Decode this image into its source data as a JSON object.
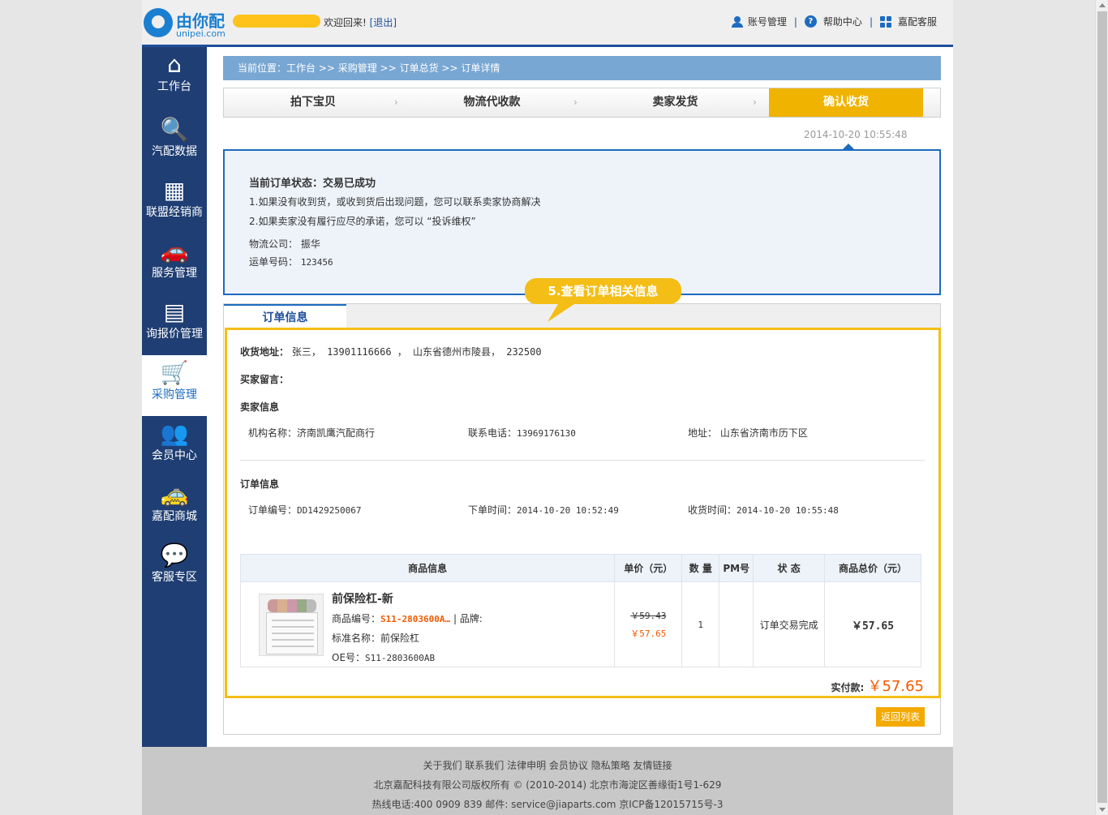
{
  "header": {
    "logo_text": "由你配",
    "logo_sub": "unipei.com",
    "welcome": "欢迎回来!",
    "logout": "[退出]",
    "links": [
      {
        "label": "账号管理",
        "icon": "user-icon"
      },
      {
        "label": "帮助中心",
        "icon": "help-icon"
      },
      {
        "label": "嘉配客服",
        "icon": "grid-icon"
      }
    ],
    "separator": "|"
  },
  "sidebar": {
    "items": [
      {
        "label": "工作台",
        "icon": "home-icon",
        "glyph": "⌂"
      },
      {
        "label": "汽配数据",
        "icon": "search-icon",
        "glyph": "🔍"
      },
      {
        "label": "联盟经销商",
        "icon": "building-icon",
        "glyph": "▦"
      },
      {
        "label": "服务管理",
        "icon": "car-icon",
        "glyph": "🚗"
      },
      {
        "label": "询报价管理",
        "icon": "document-icon",
        "glyph": "▤"
      },
      {
        "label": "采购管理",
        "icon": "cart-icon",
        "glyph": "🛒"
      },
      {
        "label": "会员中心",
        "icon": "members-icon",
        "glyph": "👥"
      },
      {
        "label": "嘉配商城",
        "icon": "taxi-icon",
        "glyph": "🚕"
      },
      {
        "label": "客服专区",
        "icon": "chat-icon",
        "glyph": "💬"
      }
    ],
    "active_index": 5
  },
  "breadcrumb": {
    "prefix": "当前位置：",
    "items": [
      "工作台",
      "采购管理",
      "订单总货",
      "订单详情"
    ],
    "sep": ">>"
  },
  "steps": [
    {
      "label": "拍下宝贝",
      "done": false
    },
    {
      "label": "物流代收款",
      "done": false
    },
    {
      "label": "卖家发货",
      "done": false
    },
    {
      "label": "确认收货",
      "done": true
    }
  ],
  "step_time": "2014-10-20 10:55:48",
  "status": {
    "title": "当前订单状态：交易已成功",
    "line1": "1.如果没有收到货，或收到货后出现问题，您可以联系卖家协商解决",
    "line2": "2.如果卖家没有履行应尽的承诺，您可以 “投诉维权”",
    "logistics_label": "物流公司：",
    "logistics_value": "振华",
    "tracking_label": "运单号码：",
    "tracking_value": "123456"
  },
  "callout": "5.查看订单相关信息",
  "tab": "订单信息",
  "order": {
    "address_label": "收货地址：",
    "address_value": "张三， 13901116666 ， 山东省德州市陵县， 232500",
    "buyer_msg_label": "买家留言：",
    "seller_head": "卖家信息",
    "org_label": "机构名称：",
    "org_value": "济南凯鹰汽配商行",
    "phone_label": "联系电话：",
    "phone_value": "13969176130",
    "addr2_label": "地址：",
    "addr2_value": "山东省济南市历下区",
    "order_head": "订单信息",
    "order_no_label": "订单编号：",
    "order_no_value": "DD1429250067",
    "order_time_label": "下单时间：",
    "order_time_value": "2014-10-20 10:52:49",
    "recv_time_label": "收货时间：",
    "recv_time_value": "2014-10-20 10:55:48"
  },
  "goods_table": {
    "headers": [
      "商品信息",
      "单价（元）",
      "数 量",
      "PM号",
      "状 态",
      "商品总价（元）"
    ],
    "row": {
      "name": "前保险杠-新",
      "sku_label": "商品编号：",
      "sku_value": "S11-2803600A…",
      "brand_label": "| 品牌:",
      "std_label": "标准名称：",
      "std_value": "前保险杠",
      "oe_label": "OE号：",
      "oe_value": "S11-2803600AB",
      "price_old": "￥59.43",
      "price_new": "￥57.65",
      "qty": "1",
      "pm": "",
      "status": "订单交易完成",
      "total": "￥57.65"
    }
  },
  "paid_label": "实付款:",
  "paid_amount": "￥57.65",
  "back_button": "返回列表",
  "footer": {
    "links": "关于我们 联系我们 法律申明 会员协议 隐私策略 友情链接",
    "copyright": "北京嘉配科技有限公司版权所有 © (2010-2014) 北京市海淀区善缘街1号1-629",
    "contact": "热线电话:400 0909 839   邮件: service@jiaparts.com   京ICP备12015715号-3"
  },
  "colors": {
    "accent": "#1d6bc0",
    "sidebar": "#1f3e73",
    "highlight": "#f4be16",
    "price": "#f05a00"
  }
}
